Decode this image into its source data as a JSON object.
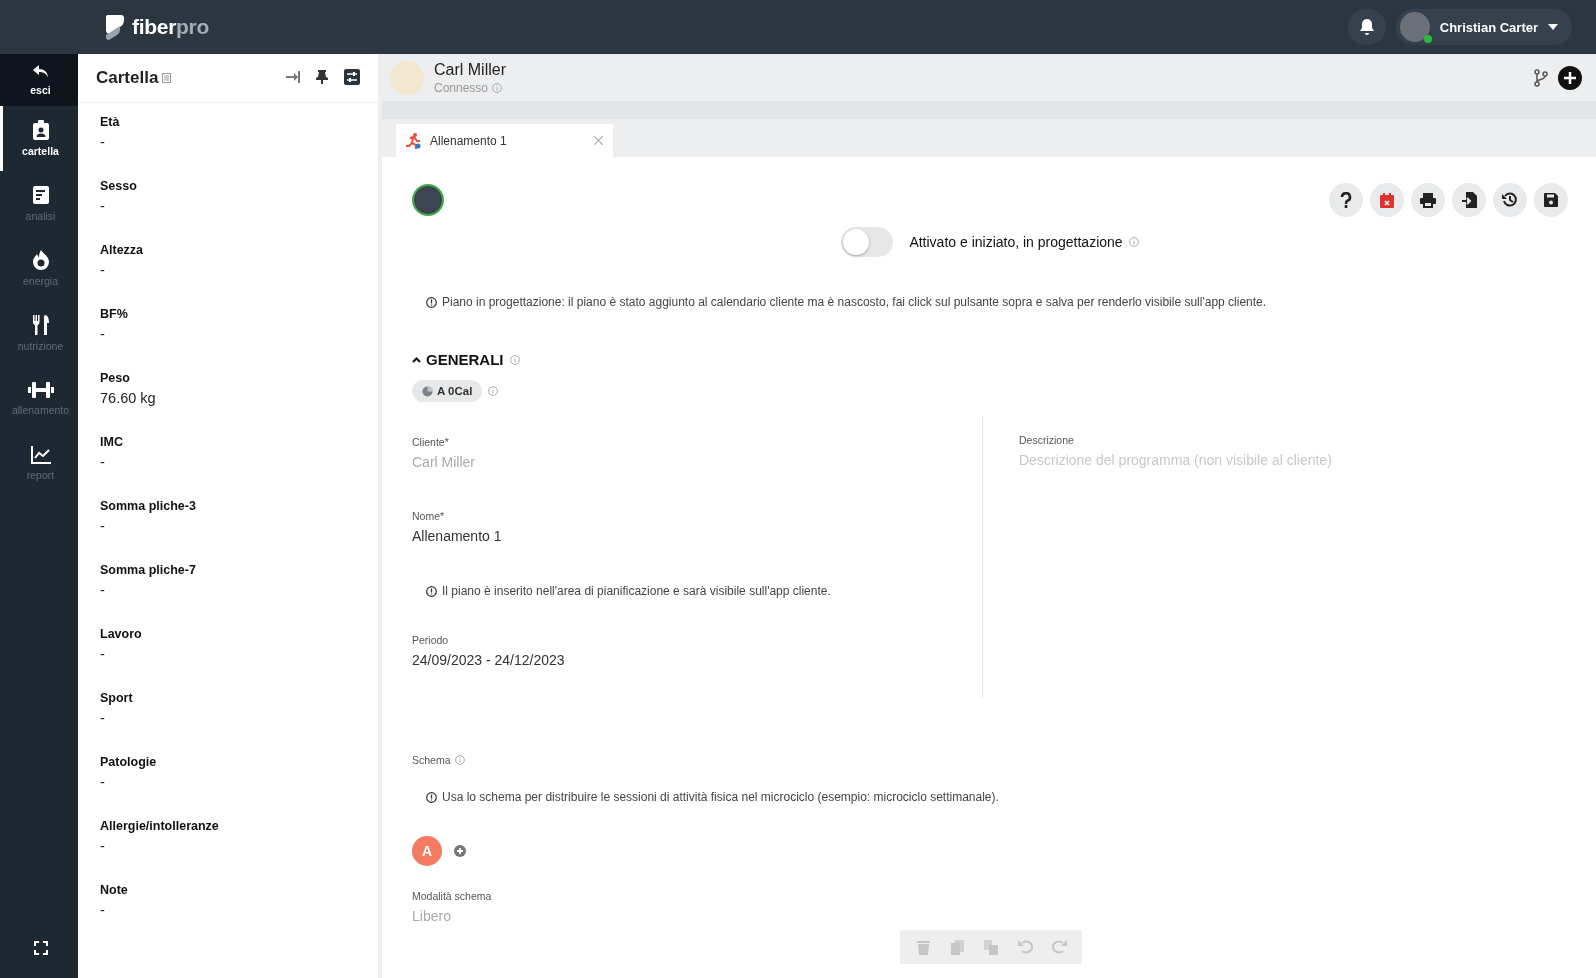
{
  "topbar": {
    "logo": "fiber",
    "logo_suffix": "pro",
    "user": {
      "name": "Christian Carter",
      "online": true
    }
  },
  "nav": {
    "back": {
      "label": "esci"
    },
    "items": [
      {
        "label": "cartella",
        "selected": true
      },
      {
        "label": "analisi",
        "selected": false
      },
      {
        "label": "energia",
        "selected": false
      },
      {
        "label": "nutrizione",
        "selected": false
      },
      {
        "label": "allenamento",
        "selected": false
      },
      {
        "label": "report",
        "selected": false
      }
    ]
  },
  "panel": {
    "title": "Cartella",
    "fields": [
      {
        "label": "Età",
        "value": "-"
      },
      {
        "label": "Sesso",
        "value": "-"
      },
      {
        "label": "Altezza",
        "value": "-"
      },
      {
        "label": "BF%",
        "value": "-"
      },
      {
        "label": "Peso",
        "value": "76.60 kg"
      },
      {
        "label": "IMC",
        "value": "-"
      },
      {
        "label": "Somma pliche-3",
        "value": "-"
      },
      {
        "label": "Somma pliche-7",
        "value": "-"
      },
      {
        "label": "Lavoro",
        "value": "-"
      },
      {
        "label": "Sport",
        "value": "-"
      },
      {
        "label": "Patologie",
        "value": "-"
      },
      {
        "label": "Allergie/intolleranze",
        "value": "-"
      },
      {
        "label": "Note",
        "value": "-"
      }
    ]
  },
  "client": {
    "name": "Carl Miller",
    "status": "Connesso"
  },
  "tabs": [
    {
      "label": "Allenamento 1",
      "selected": true
    }
  ],
  "toggle": {
    "on": false,
    "label": "Attivato e iniziato, in progettazione"
  },
  "notice": "Piano in progettazione: il piano è stato aggiunto al calendario cliente ma è nascosto, fai click sul pulsante sopra e salva per renderlo visibile sull'app cliente.",
  "section": {
    "title": "GENERALI",
    "expanded": true,
    "badge": "A 0Cal"
  },
  "form": {
    "cliente": {
      "label": "Cliente*",
      "value": "Carl Miller",
      "disabled": true
    },
    "nome": {
      "label": "Nome*",
      "value": "Allenamento 1"
    },
    "nome_notice": "Il piano è inserito nell'area di pianificazione e sarà visibile sull'app cliente.",
    "periodo": {
      "label": "Periodo",
      "value": "24/09/2023 - 24/12/2023"
    },
    "descrizione": {
      "label": "Descrizione",
      "placeholder": "Descrizione del programma (non visibile al cliente)"
    },
    "schema": {
      "label": "Schema",
      "notice": "Usa lo schema per distribuire le sessioni di attività fisica nel microciclo (esempio: microciclo settimanale).",
      "chips": [
        {
          "label": "A",
          "color": "#f47a62"
        }
      ]
    },
    "modalita": {
      "label": "Modalità schema",
      "value": "Libero",
      "disabled": true
    }
  },
  "floating_tools": [
    {
      "disabled": true
    },
    {
      "disabled": true
    },
    {
      "disabled": true
    },
    {
      "disabled": true
    },
    {
      "disabled": true
    }
  ]
}
